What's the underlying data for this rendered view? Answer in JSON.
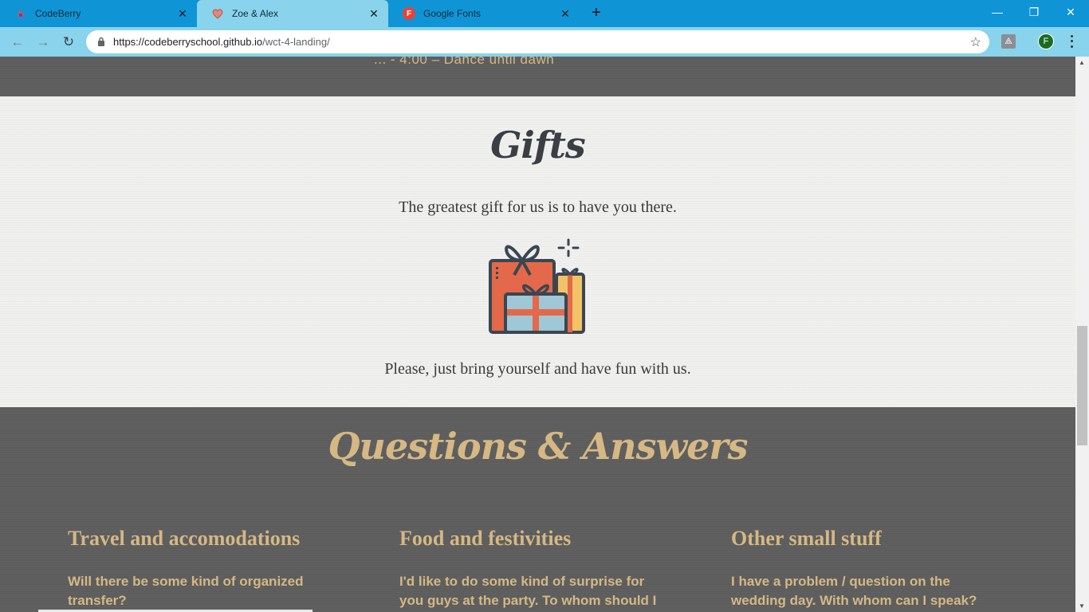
{
  "browser": {
    "tabs": [
      {
        "title": "CodeBerry",
        "icon": "codeberry-icon"
      },
      {
        "title": "Zoe & Alex",
        "icon": "heart-icon",
        "active": true
      },
      {
        "title": "Google Fonts",
        "icon": "google-fonts-icon",
        "icon_letter": "F"
      }
    ],
    "new_tab": "+",
    "url_host": "https://codeberryschool.github.io",
    "url_path": "/wct-4-landing/",
    "profile_letter": "F",
    "window_controls": {
      "minimize": "—",
      "restore": "❐",
      "close": "✕"
    }
  },
  "schedule": {
    "last_line": "... - 4:00 – Dance until dawn"
  },
  "gifts": {
    "title": "Gifts",
    "line1": "The greatest gift for us is to have you there.",
    "line2": "Please, just bring yourself and have fun with us.",
    "icon": "gift-boxes-icon"
  },
  "qa": {
    "title": "Questions & Answers",
    "columns": [
      {
        "title": "Travel and accomodations",
        "question": "Will there be some kind of organized transfer?"
      },
      {
        "title": "Food and festivities",
        "question": "I'd like to do some kind of surprise for you guys at the party. To whom should I"
      },
      {
        "title": "Other small stuff",
        "question": "I have a problem / question on the wedding day. With whom can I speak?"
      }
    ]
  },
  "colors": {
    "chrome_blue": "#0f95d6",
    "chrome_light": "#89d3ec",
    "gold": "#d5b884",
    "dark_bg": "#5d5d5d",
    "light_bg": "#f0f0ef"
  }
}
